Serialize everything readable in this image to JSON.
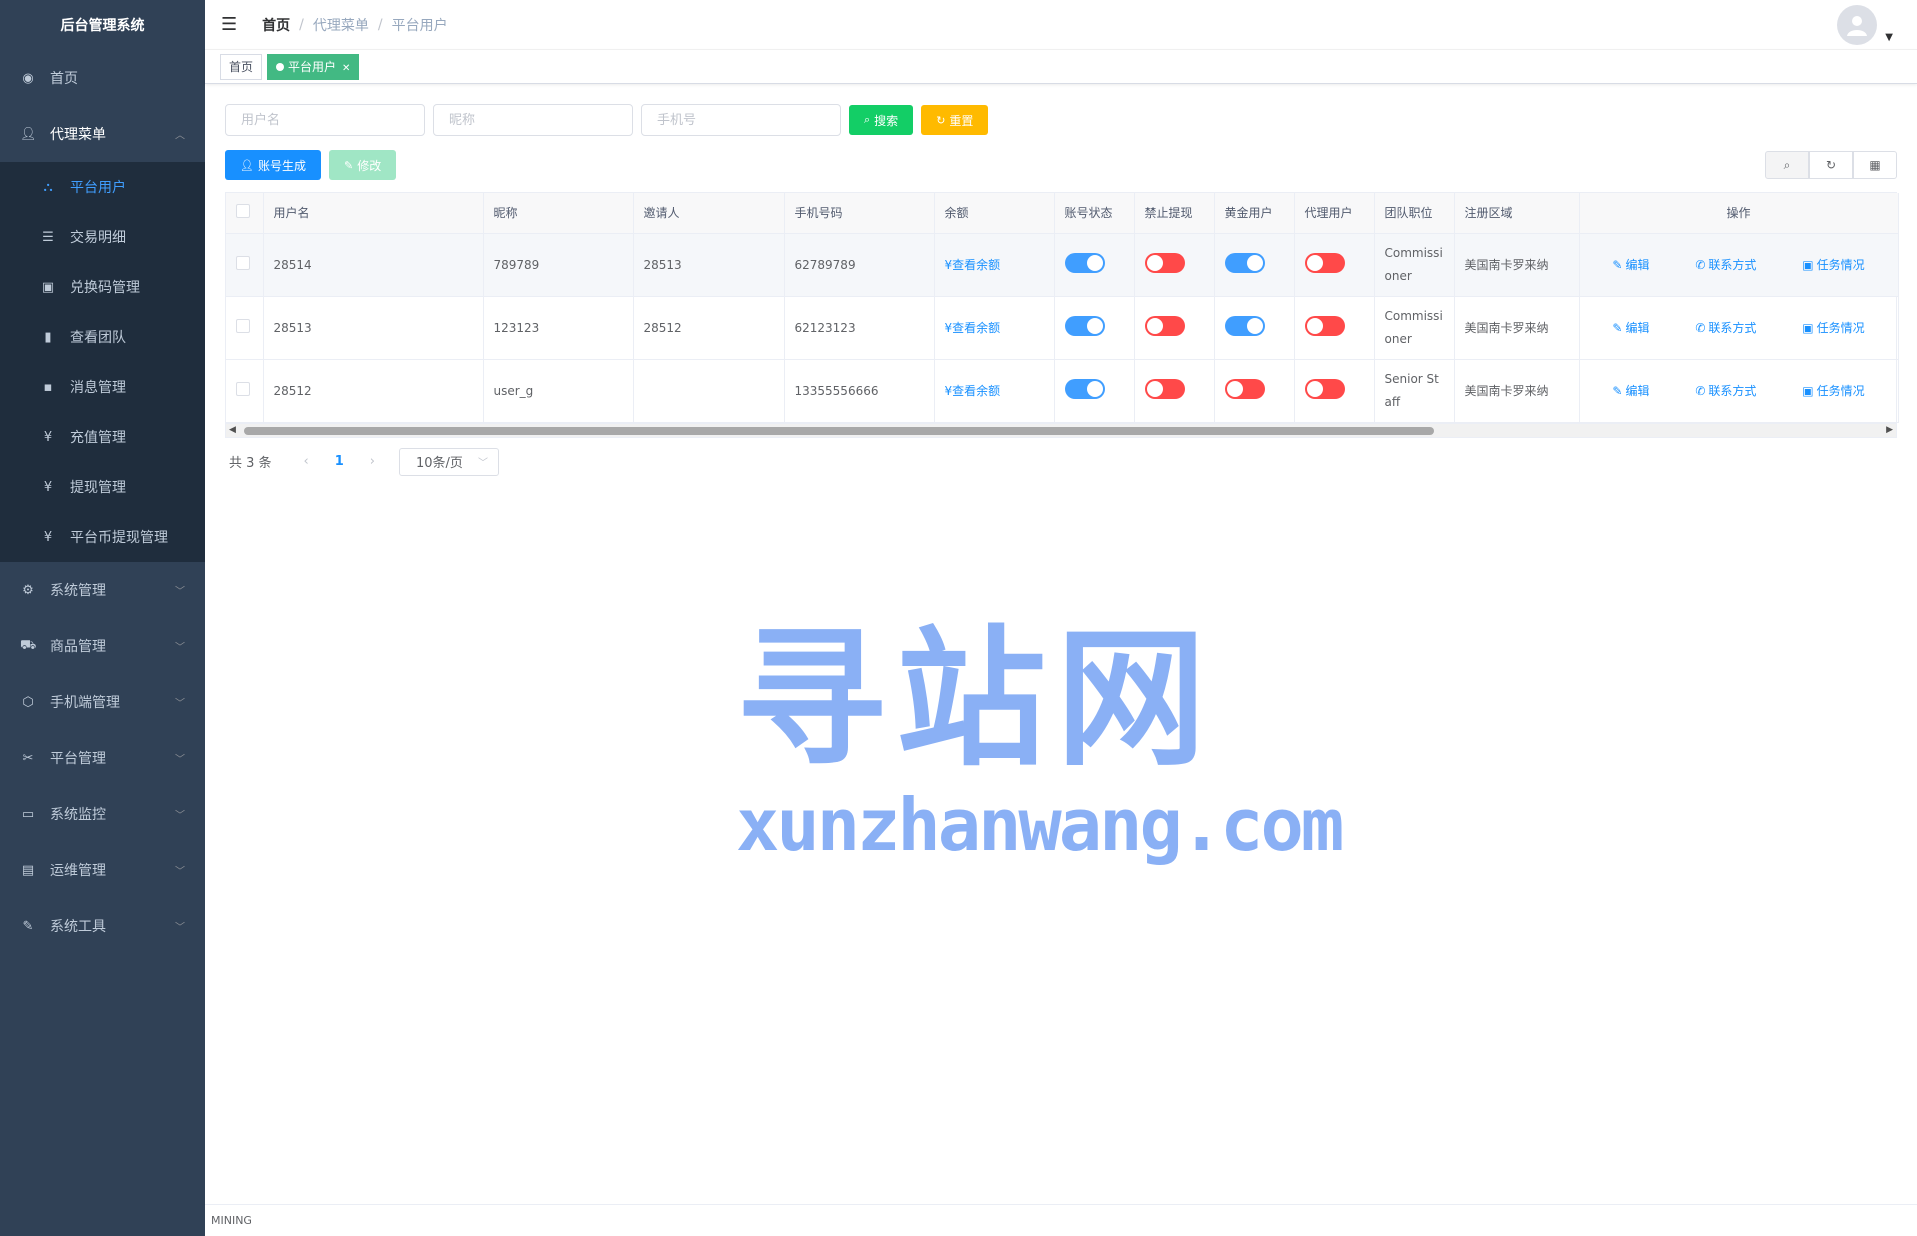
{
  "app": {
    "title": "后台管理系统"
  },
  "sidebar": {
    "home": "首页",
    "agent_menu": "代理菜单",
    "sub_items": [
      {
        "label": "平台用户",
        "icon": "sitemap-icon"
      },
      {
        "label": "交易明细",
        "icon": "list-icon"
      },
      {
        "label": "兑换码管理",
        "icon": "coupon-icon"
      },
      {
        "label": "查看团队",
        "icon": "bar-chart-icon"
      },
      {
        "label": "消息管理",
        "icon": "message-icon"
      },
      {
        "label": "充值管理",
        "icon": "yen-icon"
      },
      {
        "label": "提现管理",
        "icon": "yen-icon"
      },
      {
        "label": "平台币提现管理",
        "icon": "yen-icon"
      }
    ],
    "menus": [
      {
        "label": "系统管理",
        "icon": "gear-icon"
      },
      {
        "label": "商品管理",
        "icon": "cart-icon"
      },
      {
        "label": "手机端管理",
        "icon": "cube-icon"
      },
      {
        "label": "平台管理",
        "icon": "tools-icon"
      },
      {
        "label": "系统监控",
        "icon": "monitor-icon"
      },
      {
        "label": "运维管理",
        "icon": "server-icon"
      },
      {
        "label": "系统工具",
        "icon": "wrench-icon"
      }
    ]
  },
  "breadcrumb": [
    "首页",
    "代理菜单",
    "平台用户"
  ],
  "tags": {
    "home": "首页",
    "current": "平台用户"
  },
  "search": {
    "username_placeholder": "用户名",
    "nickname_placeholder": "昵称",
    "phone_placeholder": "手机号",
    "search_label": "搜索",
    "reset_label": "重置"
  },
  "toolbar": {
    "generate_label": "账号生成",
    "edit_label": "修改"
  },
  "table": {
    "headers": [
      "用户名",
      "昵称",
      "邀请人",
      "手机号码",
      "余额",
      "账号状态",
      "禁止提现",
      "黄金用户",
      "代理用户",
      "团队职位",
      "注册区域",
      "操作"
    ],
    "balance_link": "¥查看余额",
    "ops": {
      "edit": "编辑",
      "contact": "联系方式",
      "task": "任务情况"
    },
    "rows": [
      {
        "username": "28514",
        "nickname": "789789",
        "inviter": "28513",
        "phone": "62789789",
        "status": true,
        "no_withdraw": false,
        "gold": true,
        "agent": false,
        "position": "Commissioner",
        "region": "美国南卡罗来纳"
      },
      {
        "username": "28513",
        "nickname": "123123",
        "inviter": "28512",
        "phone": "62123123",
        "status": true,
        "no_withdraw": false,
        "gold": true,
        "agent": false,
        "position": "Commissioner",
        "region": "美国南卡罗来纳"
      },
      {
        "username": "28512",
        "nickname": "user_g",
        "inviter": "",
        "phone": "13355556666",
        "status": true,
        "no_withdraw": false,
        "gold": false,
        "agent": false,
        "position": "Senior Staff",
        "region": "美国南卡罗来纳"
      }
    ]
  },
  "pagination": {
    "total": "共 3 条",
    "current": "1",
    "page_size": "10条/页"
  },
  "watermark": {
    "cn": "寻站网",
    "en": "xunzhanwang.com"
  },
  "footer": "MINING",
  "colors": {
    "sidebar_bg": "#304156",
    "primary": "#1890ff",
    "success": "#13ce66",
    "warning": "#ffba00",
    "switch_on": "#409eff",
    "switch_off": "#ff4949"
  }
}
